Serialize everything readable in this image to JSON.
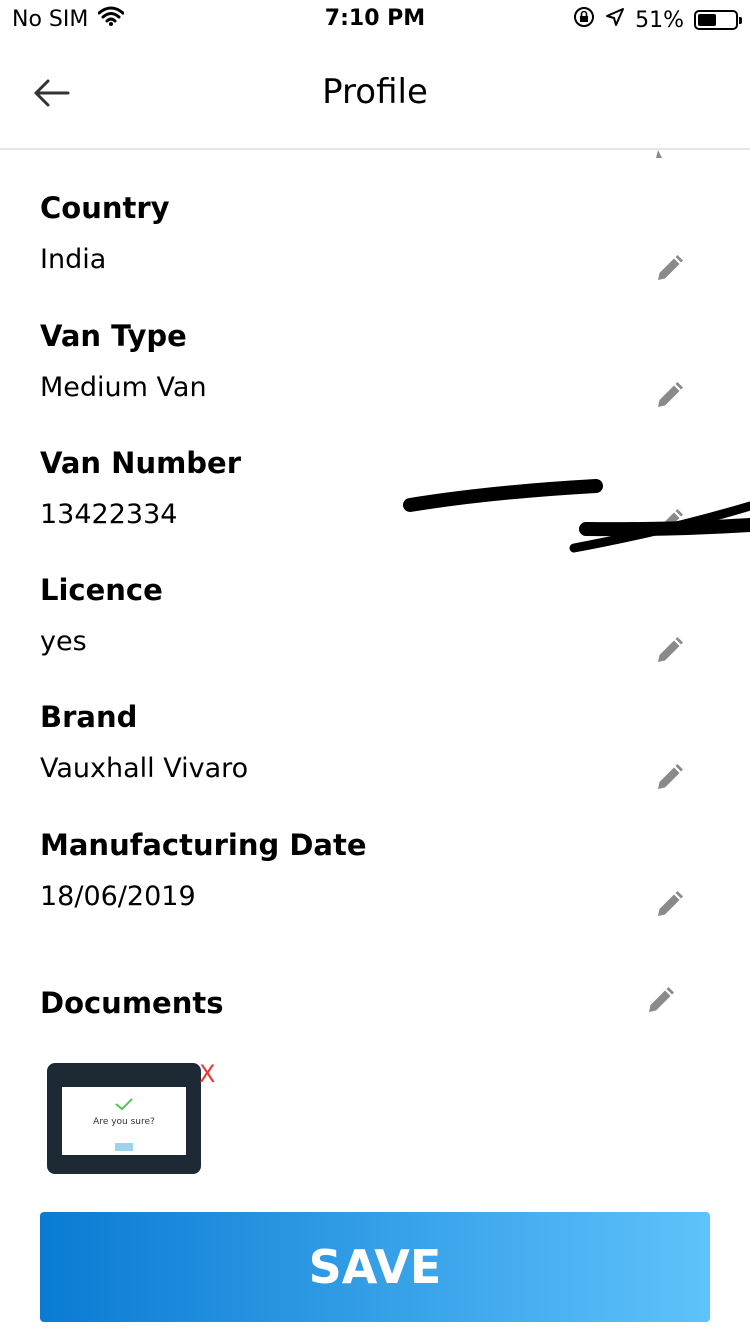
{
  "status_bar": {
    "carrier": "No SIM",
    "time": "7:10 PM",
    "battery": "51%",
    "battery_level": 0.51
  },
  "nav": {
    "title": "Profile"
  },
  "fields": [
    {
      "label": "Country",
      "value": "India"
    },
    {
      "label": "Van Type",
      "value": "Medium Van"
    },
    {
      "label": "Van Number",
      "value": "13422334"
    },
    {
      "label": "Licence",
      "value": "yes"
    },
    {
      "label": "Brand",
      "value": "Vauxhall Vivaro"
    },
    {
      "label": "Manufacturing Date",
      "value": "18/06/2019"
    }
  ],
  "documents": {
    "label": "Documents",
    "thumbnail": {
      "dialog_title": "Are you sure?"
    },
    "remove_label": "X"
  },
  "save_label": "SAVE",
  "colors": {
    "save_gradient_start": "#0a7bd3",
    "save_gradient_end": "#5ec2fb",
    "remove": "#e53935",
    "edit_icon": "#8a8a8a"
  }
}
